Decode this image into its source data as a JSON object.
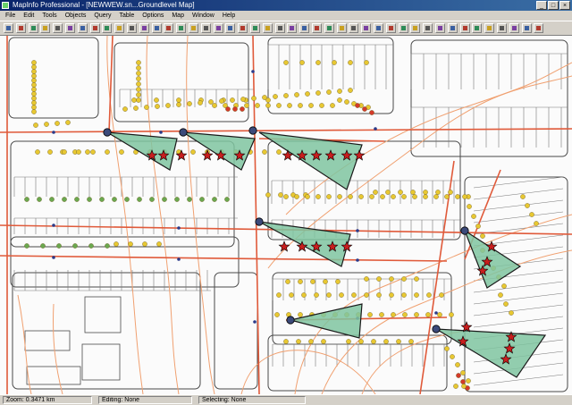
{
  "window": {
    "title": "MapInfo Professional - [NEWWEW.sn...Groundlevel Map]",
    "buttons": [
      "_",
      "□",
      "×"
    ]
  },
  "menus": [
    "File",
    "Edit",
    "Tools",
    "Objects",
    "Query",
    "Table",
    "Options",
    "Map",
    "Window",
    "Help"
  ],
  "toolbar": {
    "icons": [
      "new-icon",
      "open-icon",
      "save-icon",
      "print-icon",
      "cut-icon",
      "copy-icon",
      "paste-icon",
      "undo-icon",
      "layer-control-icon",
      "new-browser-icon",
      "new-mapper-icon",
      "new-grapher-icon",
      "new-layout-icon",
      "statistics-icon",
      "run-icon",
      "help-icon",
      "select-arrow-icon",
      "marquee-select-icon",
      "radius-select-icon",
      "polygon-select-icon",
      "boundary-select-icon",
      "unselect-icon",
      "invert-selection-icon",
      "zoom-in-icon",
      "zoom-out-icon",
      "change-view-icon",
      "grabber-icon",
      "info-icon",
      "label-icon",
      "drag-window-icon",
      "ruler-icon",
      "legend-icon",
      "show-statistics-icon",
      "line-style-icon",
      "symbol-style-icon",
      "reshape-icon",
      "add-node-icon",
      "text-icon",
      "polygon-icon",
      "polyline-icon",
      "rectangle-icon",
      "ellipse-icon",
      "arc-icon",
      "line-icon"
    ]
  },
  "map": {
    "colors": {
      "street": "#e05a3a",
      "contour": "#f0a070",
      "parcel": "#4a4a4a",
      "sector_fill": "#7fc4a0",
      "sector_stroke": "#1a1a1a",
      "site": "#3c4a7a",
      "star": "#c81e1e",
      "dot_yellow": "#e8c832",
      "dot_green": "#6aa84f",
      "dot_red": "#d43a2a"
    }
  },
  "status": {
    "zoom": "Zoom: 0.3471 km",
    "editing": "Editing: None",
    "selecting": "Selecting: None"
  }
}
